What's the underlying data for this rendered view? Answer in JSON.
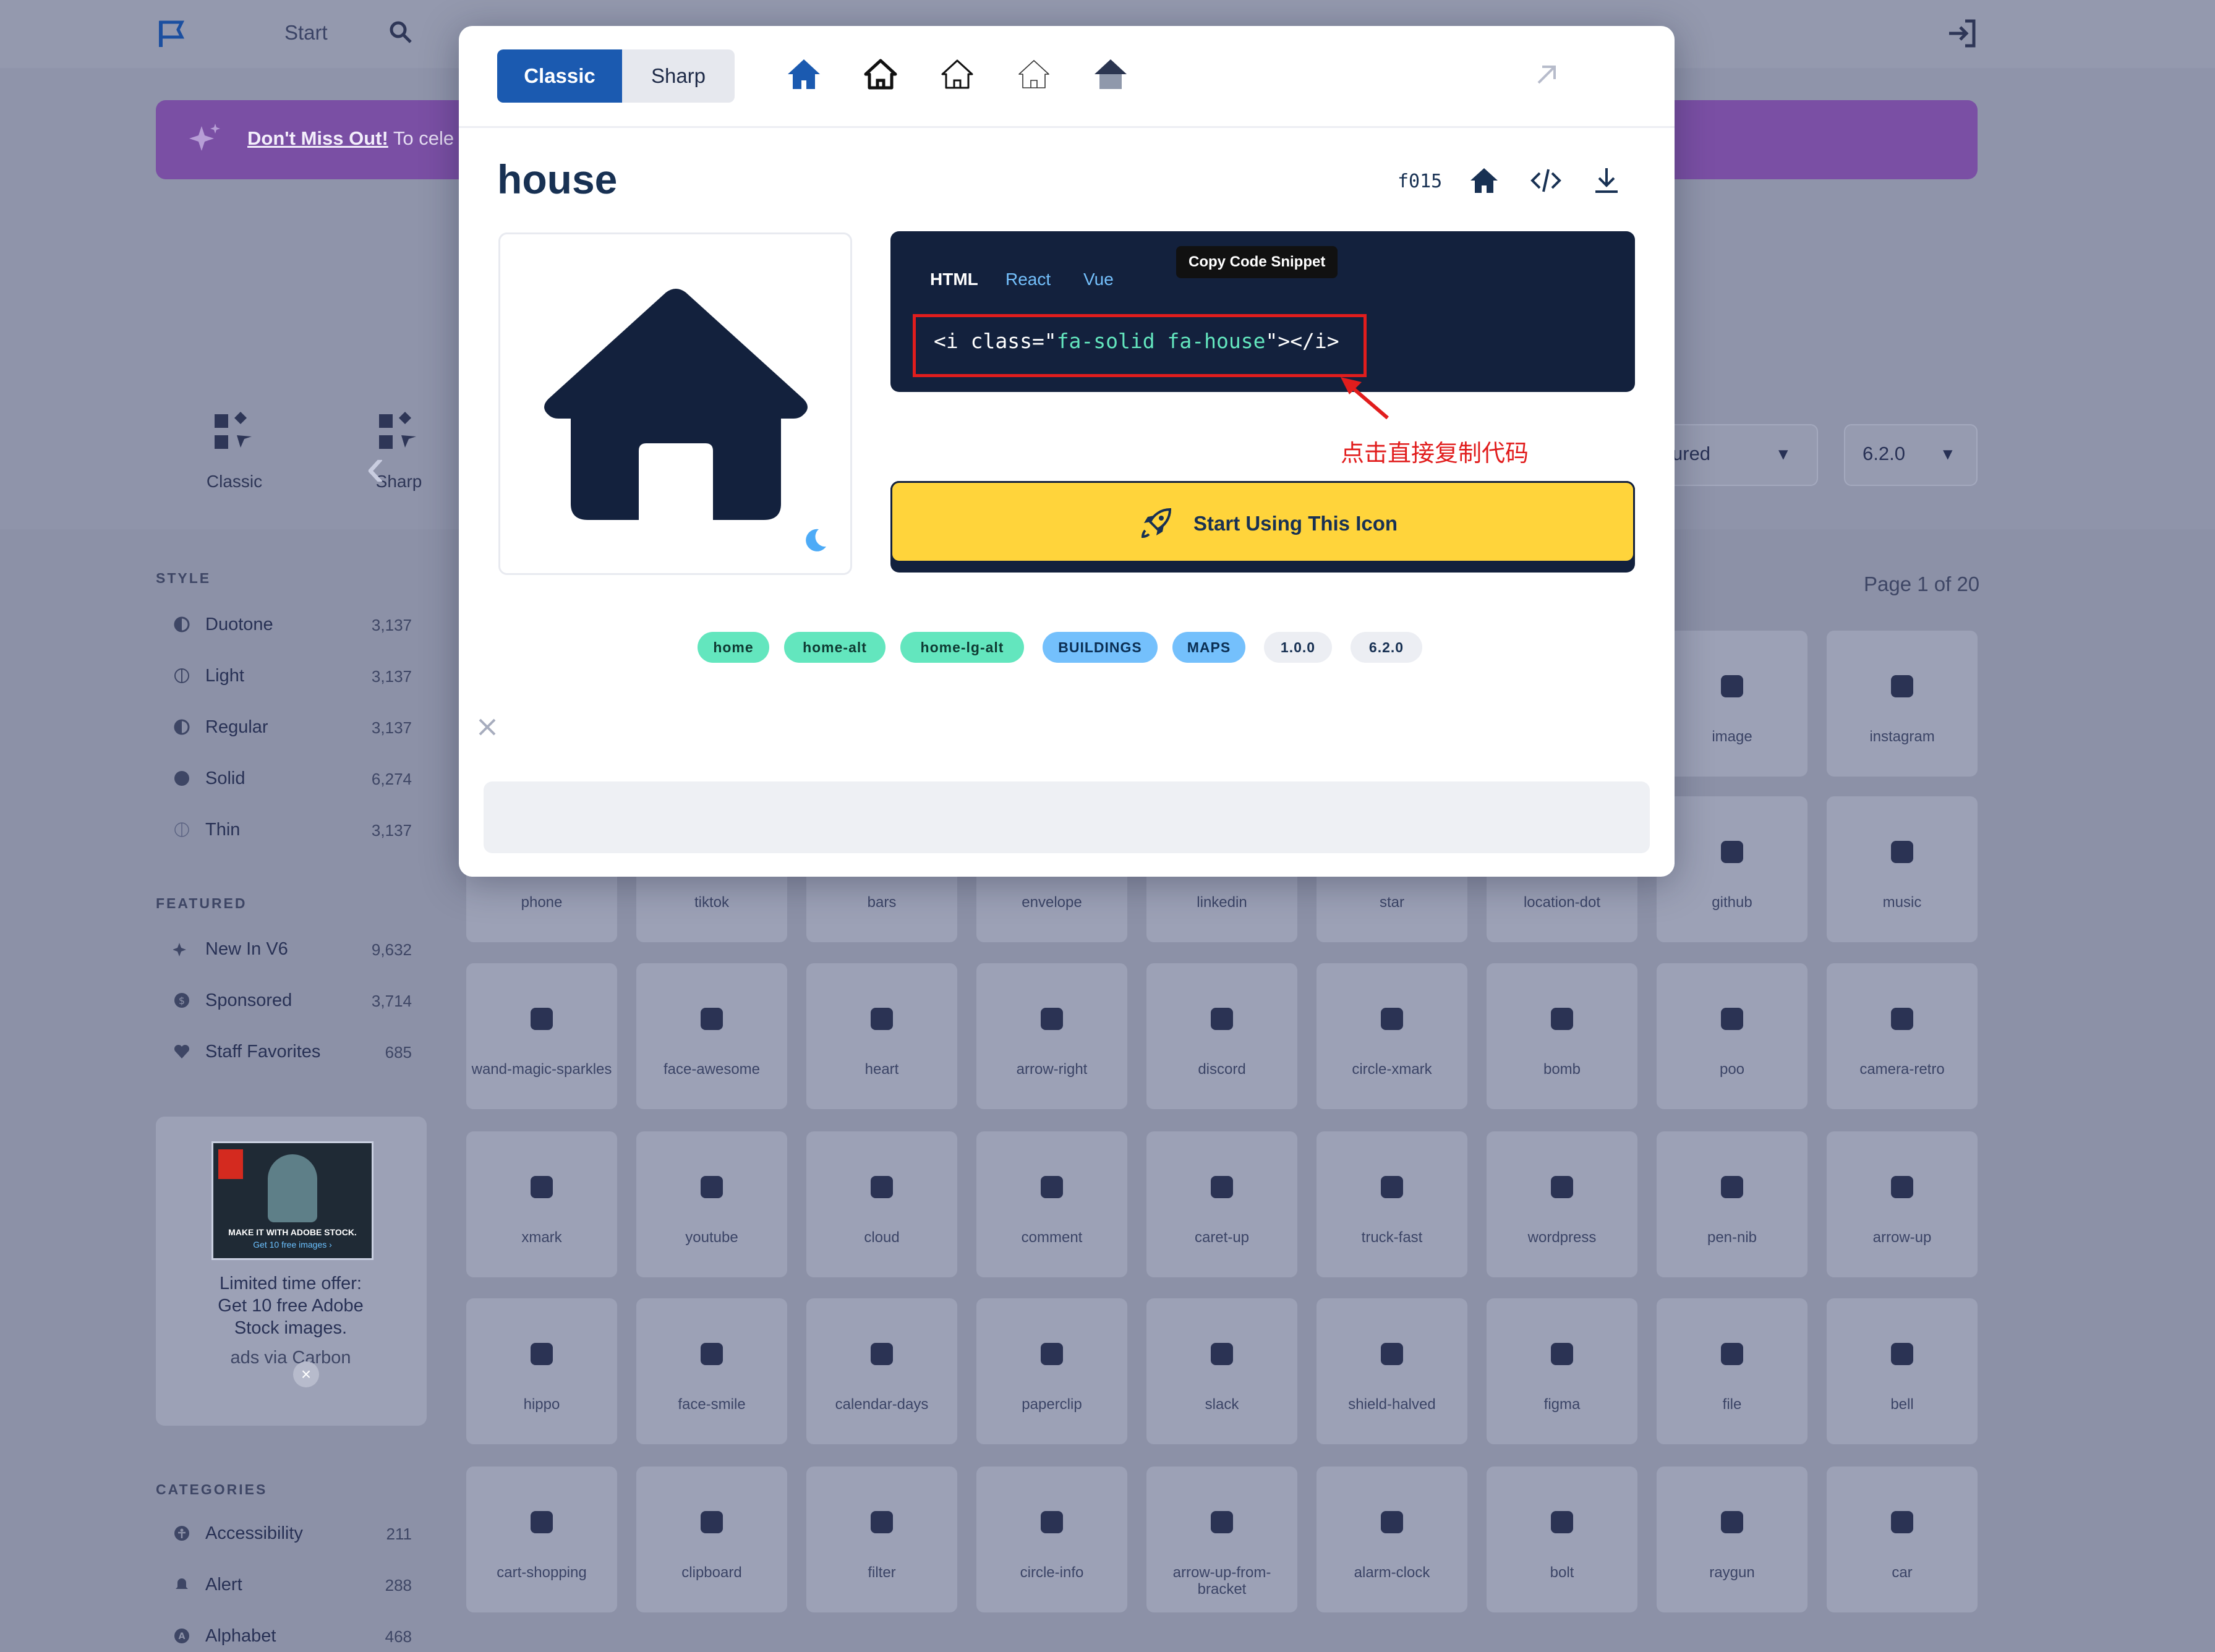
{
  "nav": {
    "start_label": "Start"
  },
  "banner": {
    "highlight": "Don't Miss Out!",
    "text": " To cele"
  },
  "styles_carousel": {
    "items": [
      {
        "label": "Classic"
      },
      {
        "label": "Sharp"
      }
    ]
  },
  "filters": {
    "featured_partial": "ured",
    "version": "6.2.0"
  },
  "sidebar": {
    "style_title": "STYLE",
    "style_items": [
      {
        "name": "Duotone",
        "count": "3,137"
      },
      {
        "name": "Light",
        "count": "3,137"
      },
      {
        "name": "Regular",
        "count": "3,137"
      },
      {
        "name": "Solid",
        "count": "6,274"
      },
      {
        "name": "Thin",
        "count": "3,137"
      }
    ],
    "featured_title": "FEATURED",
    "featured_items": [
      {
        "name": "New In V6",
        "count": "9,632"
      },
      {
        "name": "Sponsored",
        "count": "3,714"
      },
      {
        "name": "Staff Favorites",
        "count": "685"
      }
    ],
    "categories_title": "CATEGORIES",
    "category_items": [
      {
        "name": "Accessibility",
        "count": "211"
      },
      {
        "name": "Alert",
        "count": "288"
      },
      {
        "name": "Alphabet",
        "count": "468"
      }
    ]
  },
  "ad": {
    "line1": "Limited time offer:",
    "line2": "Get 10 free Adobe",
    "line3": "Stock images.",
    "via": "ads via Carbon",
    "img_caption": "MAKE IT WITH ADOBE STOCK.",
    "img_sub": "Get 10 free images ›"
  },
  "grid": {
    "page_info": "Page 1 of 20",
    "row1": [
      "image",
      "instagram"
    ],
    "row2": [
      "phone",
      "tiktok",
      "bars",
      "envelope",
      "linkedin",
      "star",
      "location-dot",
      "github",
      "music"
    ],
    "row3": [
      "wand-magic-sparkles",
      "face-awesome",
      "heart",
      "arrow-right",
      "discord",
      "circle-xmark",
      "bomb",
      "poo",
      "camera-retro"
    ],
    "row4": [
      "xmark",
      "youtube",
      "cloud",
      "comment",
      "caret-up",
      "truck-fast",
      "wordpress",
      "pen-nib",
      "arrow-up"
    ],
    "row5": [
      "hippo",
      "face-smile",
      "calendar-days",
      "paperclip",
      "slack",
      "shield-halved",
      "figma",
      "file",
      "bell"
    ],
    "row6": [
      "cart-shopping",
      "clipboard",
      "filter",
      "circle-info",
      "arrow-up-from-bracket",
      "alarm-clock",
      "bolt",
      "raygun",
      "car"
    ]
  },
  "modal": {
    "segment": {
      "classic": "Classic",
      "sharp": "Sharp"
    },
    "icon_name": "house",
    "unicode": "f015",
    "code_tabs": [
      "HTML",
      "React",
      "Vue"
    ],
    "tooltip": "Copy Code Snippet",
    "code": {
      "open": "<i class=\"",
      "classes": "fa-solid fa-house",
      "close": "\"></i>"
    },
    "annotation": "点击直接复制代码",
    "start_button": "Start Using This Icon",
    "aliases": [
      "home",
      "home-alt",
      "home-lg-alt"
    ],
    "categories": [
      "BUILDINGS",
      "MAPS"
    ],
    "versions": [
      "1.0.0",
      "6.2.0"
    ]
  },
  "colors": {
    "accent": "#1b5ab0",
    "navy": "#183153",
    "code_bg": "#13213d",
    "cta": "#ffd43b",
    "alias_tag": "#63e6be",
    "category_tag": "#74c0fc",
    "annotation": "#e11d1d"
  }
}
